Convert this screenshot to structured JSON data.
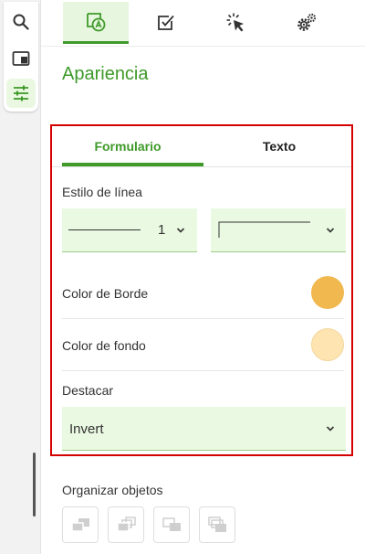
{
  "rail": {
    "items": [
      {
        "icon": "search-icon"
      },
      {
        "icon": "window-icon"
      },
      {
        "icon": "sliders-icon",
        "active": true
      }
    ]
  },
  "top_tabs": [
    {
      "icon": "appearance-icon",
      "active": true
    },
    {
      "icon": "checkbox-icon"
    },
    {
      "icon": "click-icon"
    },
    {
      "icon": "gear-icon"
    }
  ],
  "section_title": "Apariencia",
  "form": {
    "tabs": [
      {
        "label": "Formulario",
        "active": true
      },
      {
        "label": "Texto"
      }
    ],
    "line_style_label": "Estilo de línea",
    "line_width_value": "1",
    "border_color_label": "Color de Borde",
    "fill_color_label": "Color de fondo",
    "highlight_label": "Destacar",
    "highlight_value": "Invert"
  },
  "arrange": {
    "title": "Organizar objetos",
    "buttons": [
      "bring-forward-icon",
      "bring-to-front-icon",
      "send-backward-icon",
      "send-to-back-icon"
    ]
  },
  "colors": {
    "accent": "#3f9a2a",
    "border_swatch": "#f0b84f",
    "fill_swatch": "#fde4b0",
    "highlight_frame": "#d40000",
    "field_bg": "#eaf9e1"
  }
}
